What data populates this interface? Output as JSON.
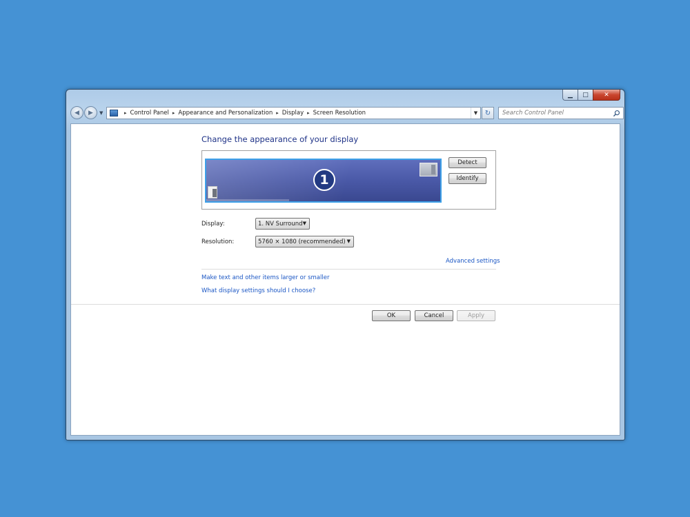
{
  "window": {
    "caption_buttons": {
      "minimize": "▁",
      "maximize": "□",
      "close": "✕"
    }
  },
  "navigation": {
    "back_glyph": "◀",
    "forward_glyph": "▶",
    "breadcrumbs": [
      "Control Panel",
      "Appearance and Personalization",
      "Display",
      "Screen Resolution"
    ],
    "separator": "▸",
    "dropdown_glyph": "▼",
    "refresh_glyph": "↻"
  },
  "search": {
    "placeholder": "Search Control Panel"
  },
  "main": {
    "heading": "Change the appearance of your display",
    "monitor": {
      "number": "1"
    },
    "detect_label": "Detect",
    "identify_label": "Identify",
    "display_label": "Display:",
    "display_value": "1. NV Surround",
    "resolution_label": "Resolution:",
    "resolution_value": "5760 × 1080 (recommended)",
    "dropdown_glyph": "▼",
    "advanced_link": "Advanced settings",
    "text_size_link": "Make text and other items larger or smaller",
    "help_link": "What display settings should I choose?",
    "ok_label": "OK",
    "cancel_label": "Cancel",
    "apply_label": "Apply"
  },
  "colors": {
    "desktop": "#4592d4",
    "heading": "#1e3287",
    "link": "#1a56c4",
    "monitor_fill": "#4a59a7",
    "monitor_border": "#3da0e8"
  }
}
